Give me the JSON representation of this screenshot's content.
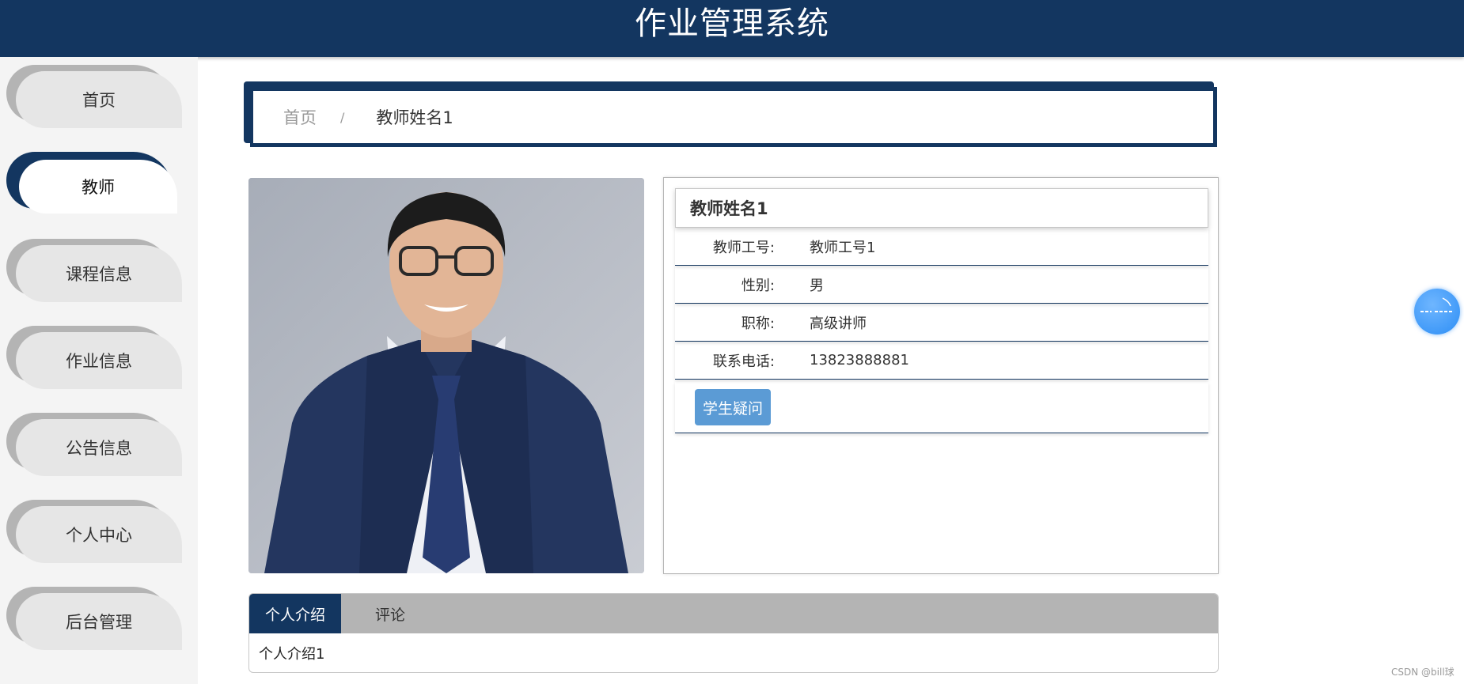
{
  "header": {
    "title": "作业管理系统"
  },
  "sidebar": {
    "items": [
      {
        "label": "首页",
        "active": false
      },
      {
        "label": "教师",
        "active": true
      },
      {
        "label": "课程信息",
        "active": false
      },
      {
        "label": "作业信息",
        "active": false
      },
      {
        "label": "公告信息",
        "active": false
      },
      {
        "label": "个人中心",
        "active": false
      },
      {
        "label": "后台管理",
        "active": false
      }
    ]
  },
  "breadcrumb": {
    "home": "首页",
    "separator": "/",
    "current": "教师姓名1"
  },
  "teacher": {
    "name": "教师姓名1",
    "fields": [
      {
        "label": "教师工号:",
        "value": "教师工号1"
      },
      {
        "label": "性别:",
        "value": "男"
      },
      {
        "label": "职称:",
        "value": "高级讲师"
      },
      {
        "label": "联系电话:",
        "value": "13823888881"
      }
    ],
    "ask_button": "学生疑问"
  },
  "tabs": {
    "items": [
      {
        "label": "个人介绍",
        "active": true
      },
      {
        "label": "评论",
        "active": false
      }
    ],
    "content": "个人介绍1"
  },
  "watermark": "CSDN @bill球",
  "colors": {
    "primary": "#133660",
    "button": "#5b9bd5",
    "float_button": "#2d8ef5"
  }
}
